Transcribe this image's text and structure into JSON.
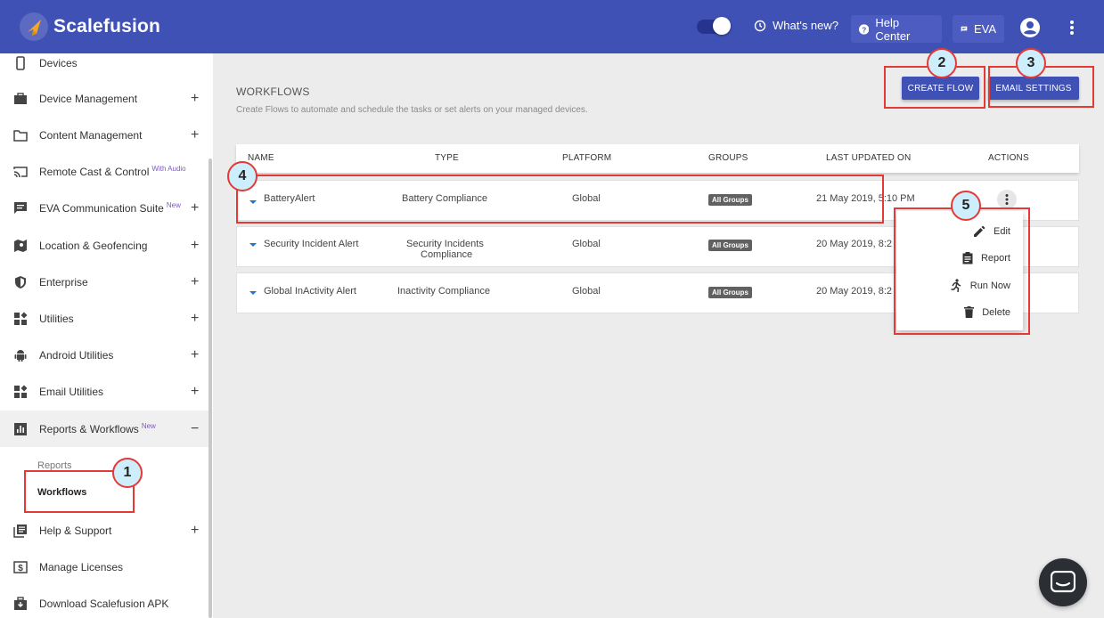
{
  "app": {
    "name": "Scalefusion",
    "brand_color": "#3f51b5",
    "accent_new_color": "#7e57c2",
    "highlight_color": "#e53935"
  },
  "topbar": {
    "whats_new_label": "What's new?",
    "help_center_label": "Help Center",
    "eva_label": "EVA",
    "toggle_on": true
  },
  "sidebar": {
    "items": [
      {
        "label": "Devices",
        "icon": "phone-icon"
      },
      {
        "label": "Device Management",
        "icon": "briefcase-icon",
        "expand": "+"
      },
      {
        "label": "Content Management",
        "icon": "folder-icon",
        "expand": "+"
      },
      {
        "label": "Remote Cast & Control",
        "tag": "With Audio",
        "icon": "cast-icon"
      },
      {
        "label": "EVA Communication Suite",
        "tag": "New",
        "icon": "chat-icon",
        "expand": "+"
      },
      {
        "label": "Location & Geofencing",
        "icon": "map-icon",
        "expand": "+"
      },
      {
        "label": "Enterprise",
        "icon": "shield-icon",
        "expand": "+"
      },
      {
        "label": "Utilities",
        "icon": "widgets-icon",
        "expand": "+"
      },
      {
        "label": "Android Utilities",
        "icon": "android-icon",
        "expand": "+"
      },
      {
        "label": "Email Utilities",
        "icon": "widgets-icon",
        "expand": "+"
      },
      {
        "label": "Reports & Workflows",
        "tag": "New",
        "icon": "bar-chart-icon",
        "expand": "−"
      },
      {
        "label": "Help & Support",
        "icon": "library-icon",
        "expand": "+"
      },
      {
        "label": "Manage Licenses",
        "icon": "dollar-icon"
      },
      {
        "label": "Download Scalefusion APK",
        "icon": "download-icon"
      }
    ],
    "sub_items": {
      "reports": "Reports",
      "workflows": "Workflows"
    }
  },
  "main": {
    "title": "WORKFLOWS",
    "subtitle": "Create Flows to automate and schedule the tasks or set alerts on your managed devices.",
    "create_flow_label": "CREATE FLOW",
    "email_settings_label": "EMAIL SETTINGS",
    "columns": [
      "NAME",
      "TYPE",
      "PLATFORM",
      "GROUPS",
      "LAST UPDATED ON",
      "ACTIONS"
    ],
    "rows": [
      {
        "name": "BatteryAlert",
        "type": "Battery Compliance",
        "platform": "Global",
        "groups": "All Groups",
        "updated": "21 May 2019, 5:10 PM"
      },
      {
        "name": "Security Incident Alert",
        "type": "Security Incidents",
        "type2": "Compliance",
        "platform": "Global",
        "groups": "All Groups",
        "updated": "20 May 2019, 8:2"
      },
      {
        "name": "Global InActivity Alert",
        "type": "Inactivity Compliance",
        "platform": "Global",
        "groups": "All Groups",
        "updated": "20 May 2019, 8:2"
      }
    ],
    "action_menu": {
      "edit": "Edit",
      "report": "Report",
      "run_now": "Run Now",
      "delete": "Delete"
    }
  },
  "annotations": {
    "m1": "1",
    "m2": "2",
    "m3": "3",
    "m4": "4",
    "m5": "5"
  }
}
